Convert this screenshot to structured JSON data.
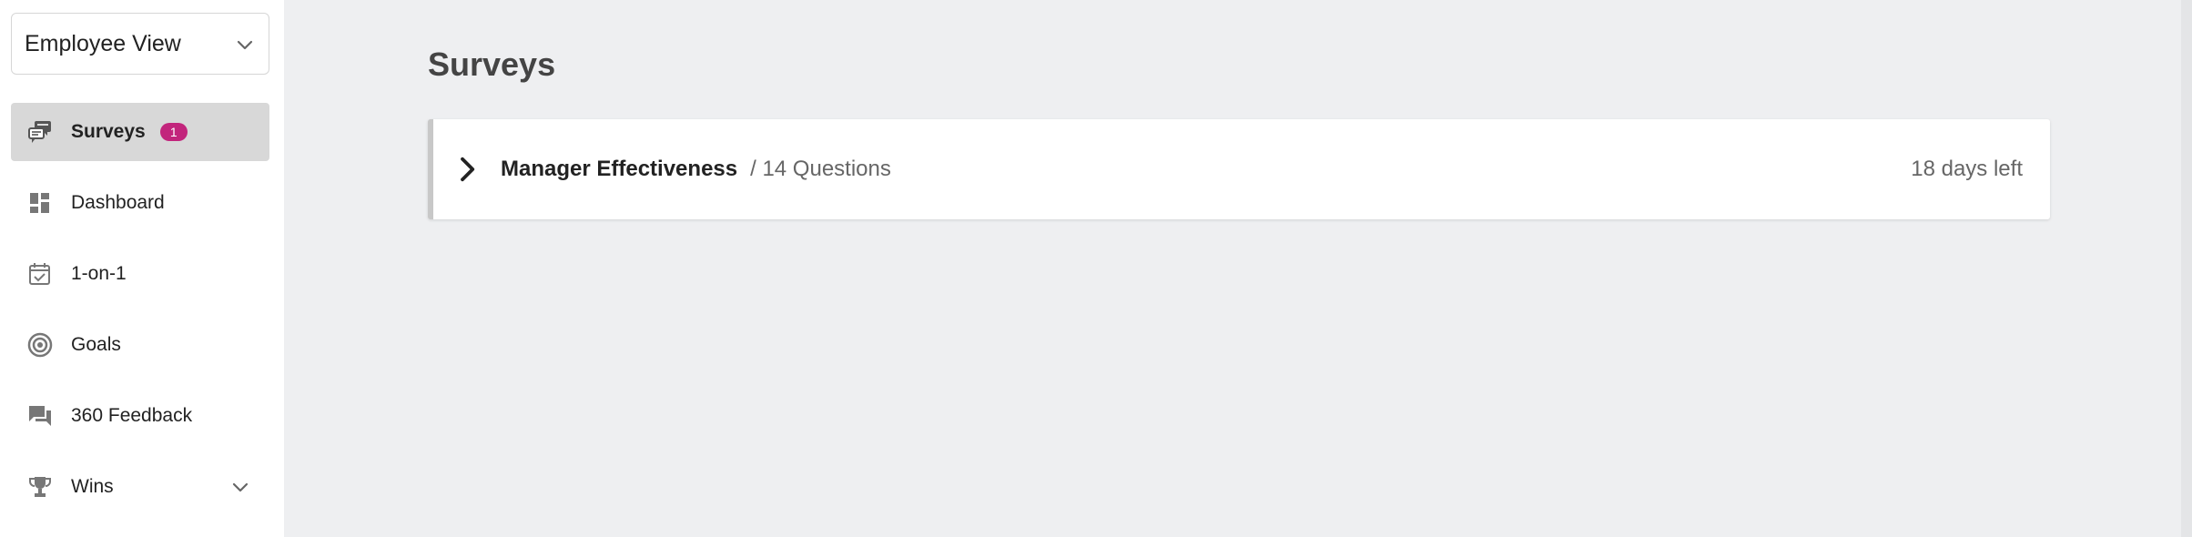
{
  "sidebar": {
    "view_selector": {
      "label": "Employee View"
    },
    "items": [
      {
        "label": "Surveys",
        "icon": "survey-icon",
        "active": true,
        "badge": "1"
      },
      {
        "label": "Dashboard",
        "icon": "dashboard-icon"
      },
      {
        "label": "1-on-1",
        "icon": "calendar-check-icon"
      },
      {
        "label": "Goals",
        "icon": "target-icon"
      },
      {
        "label": "360 Feedback",
        "icon": "feedback-icon"
      },
      {
        "label": "Wins",
        "icon": "trophy-icon",
        "expandable": true
      }
    ]
  },
  "main": {
    "title": "Surveys",
    "surveys": [
      {
        "name": "Manager Effectiveness",
        "questions": "/ 14 Questions",
        "days_left": "18 days left"
      }
    ]
  },
  "colors": {
    "badge": "#c2257c",
    "active_item": "#d8d8d8",
    "background": "#eeeff1"
  }
}
